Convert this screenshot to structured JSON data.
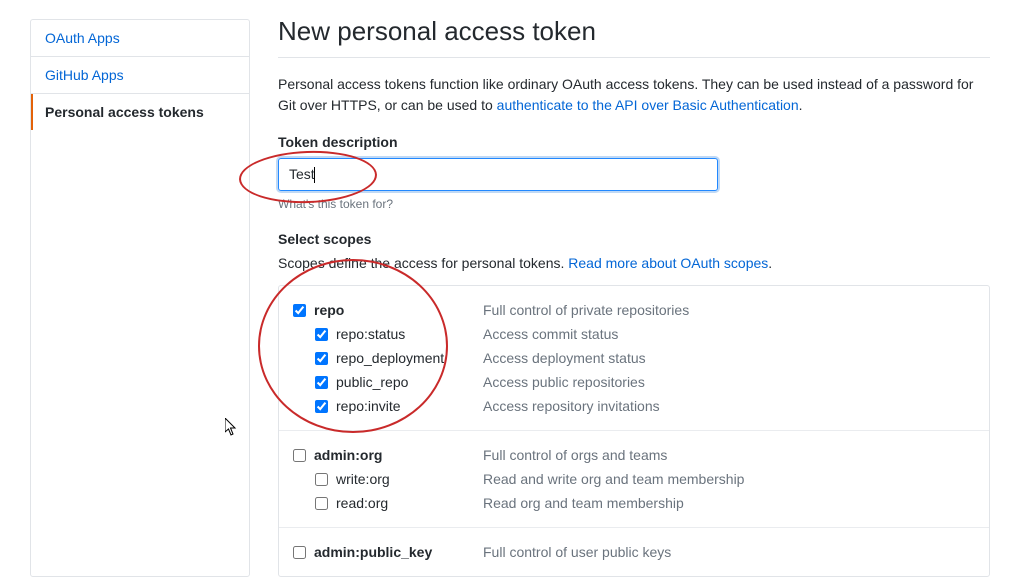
{
  "sidebar": {
    "items": [
      {
        "label": "OAuth Apps"
      },
      {
        "label": "GitHub Apps"
      },
      {
        "label": "Personal access tokens"
      }
    ]
  },
  "page": {
    "title": "New personal access token",
    "intro_prefix": "Personal access tokens function like ordinary OAuth access tokens. They can be used instead of a password for Git over HTTPS, or can be used to ",
    "intro_link": "authenticate to the API over Basic Authentication",
    "intro_suffix": "."
  },
  "token": {
    "label": "Token description",
    "value": "Test",
    "help": "What's this token for?"
  },
  "scopes": {
    "heading": "Select scopes",
    "intro_prefix": "Scopes define the access for personal tokens. ",
    "intro_link": "Read more about OAuth scopes",
    "intro_suffix": ".",
    "groups": [
      {
        "name": "repo",
        "desc": "Full control of private repositories",
        "checked": true,
        "children": [
          {
            "name": "repo:status",
            "desc": "Access commit status",
            "checked": true
          },
          {
            "name": "repo_deployment",
            "desc": "Access deployment status",
            "checked": true
          },
          {
            "name": "public_repo",
            "desc": "Access public repositories",
            "checked": true
          },
          {
            "name": "repo:invite",
            "desc": "Access repository invitations",
            "checked": true
          }
        ]
      },
      {
        "name": "admin:org",
        "desc": "Full control of orgs and teams",
        "checked": false,
        "children": [
          {
            "name": "write:org",
            "desc": "Read and write org and team membership",
            "checked": false
          },
          {
            "name": "read:org",
            "desc": "Read org and team membership",
            "checked": false
          }
        ]
      },
      {
        "name": "admin:public_key",
        "desc": "Full control of user public keys",
        "checked": false,
        "children": []
      }
    ]
  }
}
